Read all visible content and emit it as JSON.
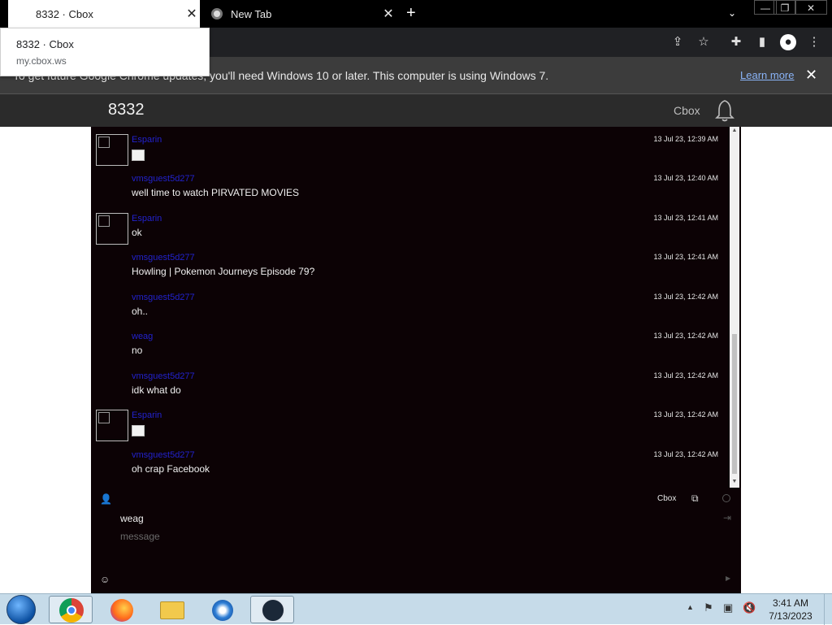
{
  "browser": {
    "tabs": [
      {
        "title": "8332 · Cbox",
        "active": true
      },
      {
        "title": "New Tab",
        "active": false
      }
    ],
    "tooltip": {
      "title": "8332 · Cbox",
      "url": "my.cbox.ws"
    },
    "infobar": {
      "message": "To get future Google Chrome updates, you'll need Windows 10 or later. This computer is using Windows 7.",
      "link": "Learn more"
    }
  },
  "site": {
    "brand": "8332",
    "cbox_label": "Cbox"
  },
  "chat": {
    "messages": [
      {
        "user": "Esparin",
        "text": "",
        "image": true,
        "time": "13 Jul 23, 12:39 AM",
        "avatar": true
      },
      {
        "user": "vmsguest5d277",
        "text": "well time to watch PIRVATED MOVIES",
        "image": false,
        "time": "13 Jul 23, 12:40 AM",
        "avatar": false
      },
      {
        "user": "Esparin",
        "text": "ok",
        "image": false,
        "time": "13 Jul 23, 12:41 AM",
        "avatar": true
      },
      {
        "user": "vmsguest5d277",
        "text": "Howling | Pokemon Journeys Episode 79?",
        "image": false,
        "time": "13 Jul 23, 12:41 AM",
        "avatar": false
      },
      {
        "user": "vmsguest5d277",
        "text": "oh..",
        "image": false,
        "time": "13 Jul 23, 12:42 AM",
        "avatar": false
      },
      {
        "user": "weag",
        "text": "no",
        "image": false,
        "time": "13 Jul 23, 12:42 AM",
        "avatar": false
      },
      {
        "user": "vmsguest5d277",
        "text": "idk what do",
        "image": false,
        "time": "13 Jul 23, 12:42 AM",
        "avatar": false
      },
      {
        "user": "Esparin",
        "text": "",
        "image": true,
        "time": "13 Jul 23, 12:42 AM",
        "avatar": true
      },
      {
        "user": "vmsguest5d277",
        "text": "oh crap Facebook",
        "image": false,
        "time": "13 Jul 23, 12:42 AM",
        "avatar": false
      }
    ],
    "footer_cbox": "Cbox",
    "name_value": "weag",
    "message_placeholder": "message"
  },
  "taskbar": {
    "time": "3:41 AM",
    "date": "7/13/2023"
  },
  "colors": {
    "chat_bg": "#0c0205",
    "username": "#2222cc",
    "header_bg": "#2b2b2b"
  }
}
